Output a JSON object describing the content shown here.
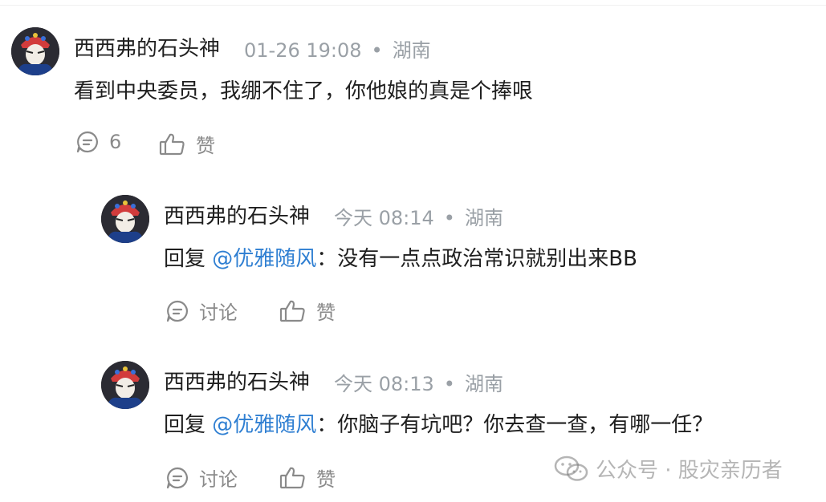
{
  "comments": [
    {
      "author": "西西弗的石头神",
      "time": "01-26 19:08",
      "location": "湖南",
      "text": "看到中央委员，我绷不住了，你他娘的真是个捧哏",
      "reply_count": "6",
      "like_label": "赞"
    },
    {
      "author": "西西弗的石头神",
      "time": "今天 08:14",
      "location": "湖南",
      "reply_prefix": "回复 ",
      "mention": "@优雅随风",
      "text": "：没有一点点政治常识就别出来BB",
      "discuss_label": "讨论",
      "like_label": "赞"
    },
    {
      "author": "西西弗的石头神",
      "time": "今天 08:13",
      "location": "湖南",
      "reply_prefix": "回复 ",
      "mention": "@优雅随风",
      "text": "：你脑子有坑吧？你去查一查，有哪一任？",
      "discuss_label": "讨论",
      "like_label": "赞"
    }
  ],
  "separator_dot": "•",
  "watermark": "公众号 · 股灾亲历者",
  "icons": [
    "comment-icon",
    "thumbs-up-icon",
    "wechat-icon"
  ]
}
